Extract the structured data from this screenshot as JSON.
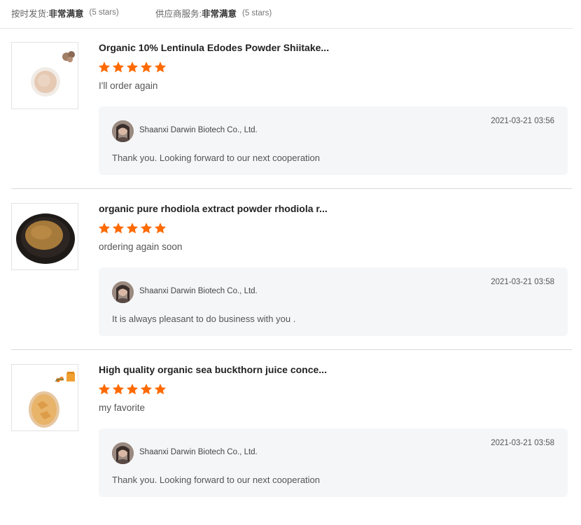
{
  "summary": {
    "delivery_label": "按时发货: ",
    "delivery_value": "非常满意",
    "delivery_stars": "(5 stars)",
    "service_label": "供应商服务: ",
    "service_value": "非常满意",
    "service_stars": "(5 stars)"
  },
  "colors": {
    "star": "#ff6a00",
    "reply_bg": "#f5f6f8"
  },
  "reviews": [
    {
      "product_title": "Organic 10% Lentinula Edodes Powder Shiitake...",
      "rating": 5,
      "comment": "I'll order again",
      "reply": {
        "seller": "Shaanxi Darwin Biotech Co., Ltd.",
        "date": "2021-03-21 03:56",
        "text": "Thank you. Looking forward to our next cooperation"
      }
    },
    {
      "product_title": "organic pure rhodiola extract powder rhodiola r...",
      "rating": 5,
      "comment": "ordering again soon",
      "reply": {
        "seller": "Shaanxi Darwin Biotech Co., Ltd.",
        "date": "2021-03-21 03:58",
        "text": "It is always pleasant to do business with you ."
      }
    },
    {
      "product_title": "High quality organic sea buckthorn juice conce...",
      "rating": 5,
      "comment": "my favorite",
      "reply": {
        "seller": "Shaanxi Darwin Biotech Co., Ltd.",
        "date": "2021-03-21 03:58",
        "text": "Thank you. Looking forward to our next cooperation"
      }
    }
  ]
}
